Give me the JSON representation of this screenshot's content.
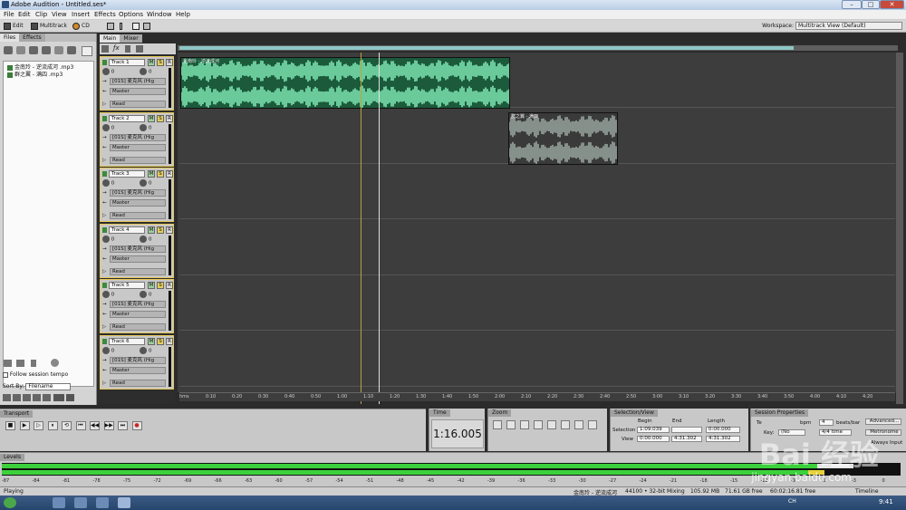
{
  "window": {
    "title": "Adobe Audition - Untitled.ses*",
    "min": "–",
    "max": "□",
    "close": "✕"
  },
  "menu": [
    "File",
    "Edit",
    "Clip",
    "View",
    "Insert",
    "Effects",
    "Options",
    "Window",
    "Help"
  ],
  "toolbar": {
    "edit": "Edit",
    "multitrack": "Multitrack",
    "cd": "CD",
    "workspace_label": "Workspace:",
    "workspace_value": "Multitrack View (Default)"
  },
  "left_panel": {
    "tabs": [
      "Files",
      "Effects"
    ],
    "files": [
      "金南玲 - 逆流成河 .mp3",
      "群之翼 - 满四 .mp3"
    ],
    "follow_tempo": "Follow session tempo",
    "sort_by_label": "Sort By:",
    "sort_by_value": "Filename"
  },
  "view_tabs": [
    "Main",
    "Mixer"
  ],
  "tracks": [
    {
      "name": "Track 1",
      "vol": "0",
      "pan": "0",
      "input": "[01S] 麦克风 (Hig",
      "output": "Master",
      "mode": "Read"
    },
    {
      "name": "Track 2",
      "vol": "0",
      "pan": "0",
      "input": "[01S] 麦克风 (Hig",
      "output": "Master",
      "mode": "Read"
    },
    {
      "name": "Track 3",
      "vol": "0",
      "pan": "0",
      "input": "[01S] 麦克风 (Hig",
      "output": "Master",
      "mode": "Read"
    },
    {
      "name": "Track 4",
      "vol": "0",
      "pan": "0",
      "input": "[01S] 麦克风 (Hig",
      "output": "Master",
      "mode": "Read"
    },
    {
      "name": "Track 5",
      "vol": "0",
      "pan": "0",
      "input": "[01S] 麦克风 (Hig",
      "output": "Master",
      "mode": "Read"
    },
    {
      "name": "Track 6",
      "vol": "0",
      "pan": "0",
      "input": "[01S] 麦克风 (Hig",
      "output": "Master",
      "mode": "Read"
    }
  ],
  "msr": [
    "M",
    "S",
    "R"
  ],
  "clips": [
    {
      "title": "金南玲 - 逆流成河",
      "color": "#7fe6b2"
    },
    {
      "title": "群之翼 - 满四",
      "color": "#9aa6a0"
    }
  ],
  "ruler": [
    "hms",
    "0:10",
    "0:20",
    "0:30",
    "0:40",
    "0:50",
    "1:00",
    "1:10",
    "1:20",
    "1:30",
    "1:40",
    "1:50",
    "2:00",
    "2:10",
    "2:20",
    "2:30",
    "2:40",
    "2:50",
    "3:00",
    "3:10",
    "3:20",
    "3:30",
    "3:40",
    "3:50",
    "4:00",
    "4:10",
    "4:20"
  ],
  "transport": {
    "title": "Transport",
    "buttons": [
      "■",
      "▶",
      "▷",
      "⏸",
      "⟲",
      "⏮",
      "◀◀",
      "▶▶",
      "⏭",
      "●"
    ]
  },
  "time": {
    "title": "Time",
    "value": "1:16.005"
  },
  "zoom": {
    "title": "Zoom"
  },
  "selection": {
    "title": "Selection/View",
    "begin": "Begin",
    "end": "End",
    "length": "Length",
    "sel_label": "Selection",
    "view_label": "View",
    "sel_begin": "1:09.039",
    "sel_end": "",
    "sel_length": "0:00.000",
    "view_begin": "0:00.000",
    "view_end": "4:31.302",
    "view_length": "4:31.302"
  },
  "session": {
    "title": "Session Properties",
    "tempo": "Te",
    "bpm": "bpm",
    "beats": "4",
    "beats_label": "beats/bar",
    "advanced": "Advanced...",
    "time_sig": "4/4 time",
    "key": "Key:",
    "key_val": "(No",
    "metronome": "Metronome",
    "always_input": "Always Input"
  },
  "levels": {
    "title": "Levels",
    "scale": [
      "-87",
      "-84",
      "-81",
      "-78",
      "-75",
      "-72",
      "-69",
      "-66",
      "-63",
      "-60",
      "-57",
      "-54",
      "-51",
      "-48",
      "-45",
      "-42",
      "-39",
      "-36",
      "-33",
      "-30",
      "-27",
      "-24",
      "-21",
      "-18",
      "-15",
      "-12",
      "-9",
      "-6",
      "-3",
      "0"
    ]
  },
  "status": {
    "left": "Playing",
    "file": "金南玲 - 逆流成河",
    "format": "44100 • 32-bit Mixing",
    "mem": "105.92 MB",
    "disk": "71.61 GB free",
    "dur": "60:02:16.81 free",
    "mode": "Timeline"
  },
  "taskbar": {
    "clock": "9:41",
    "lang": "CH"
  },
  "watermark": {
    "brand": "Bai 经验",
    "url": "jingyan.baidu.com"
  }
}
